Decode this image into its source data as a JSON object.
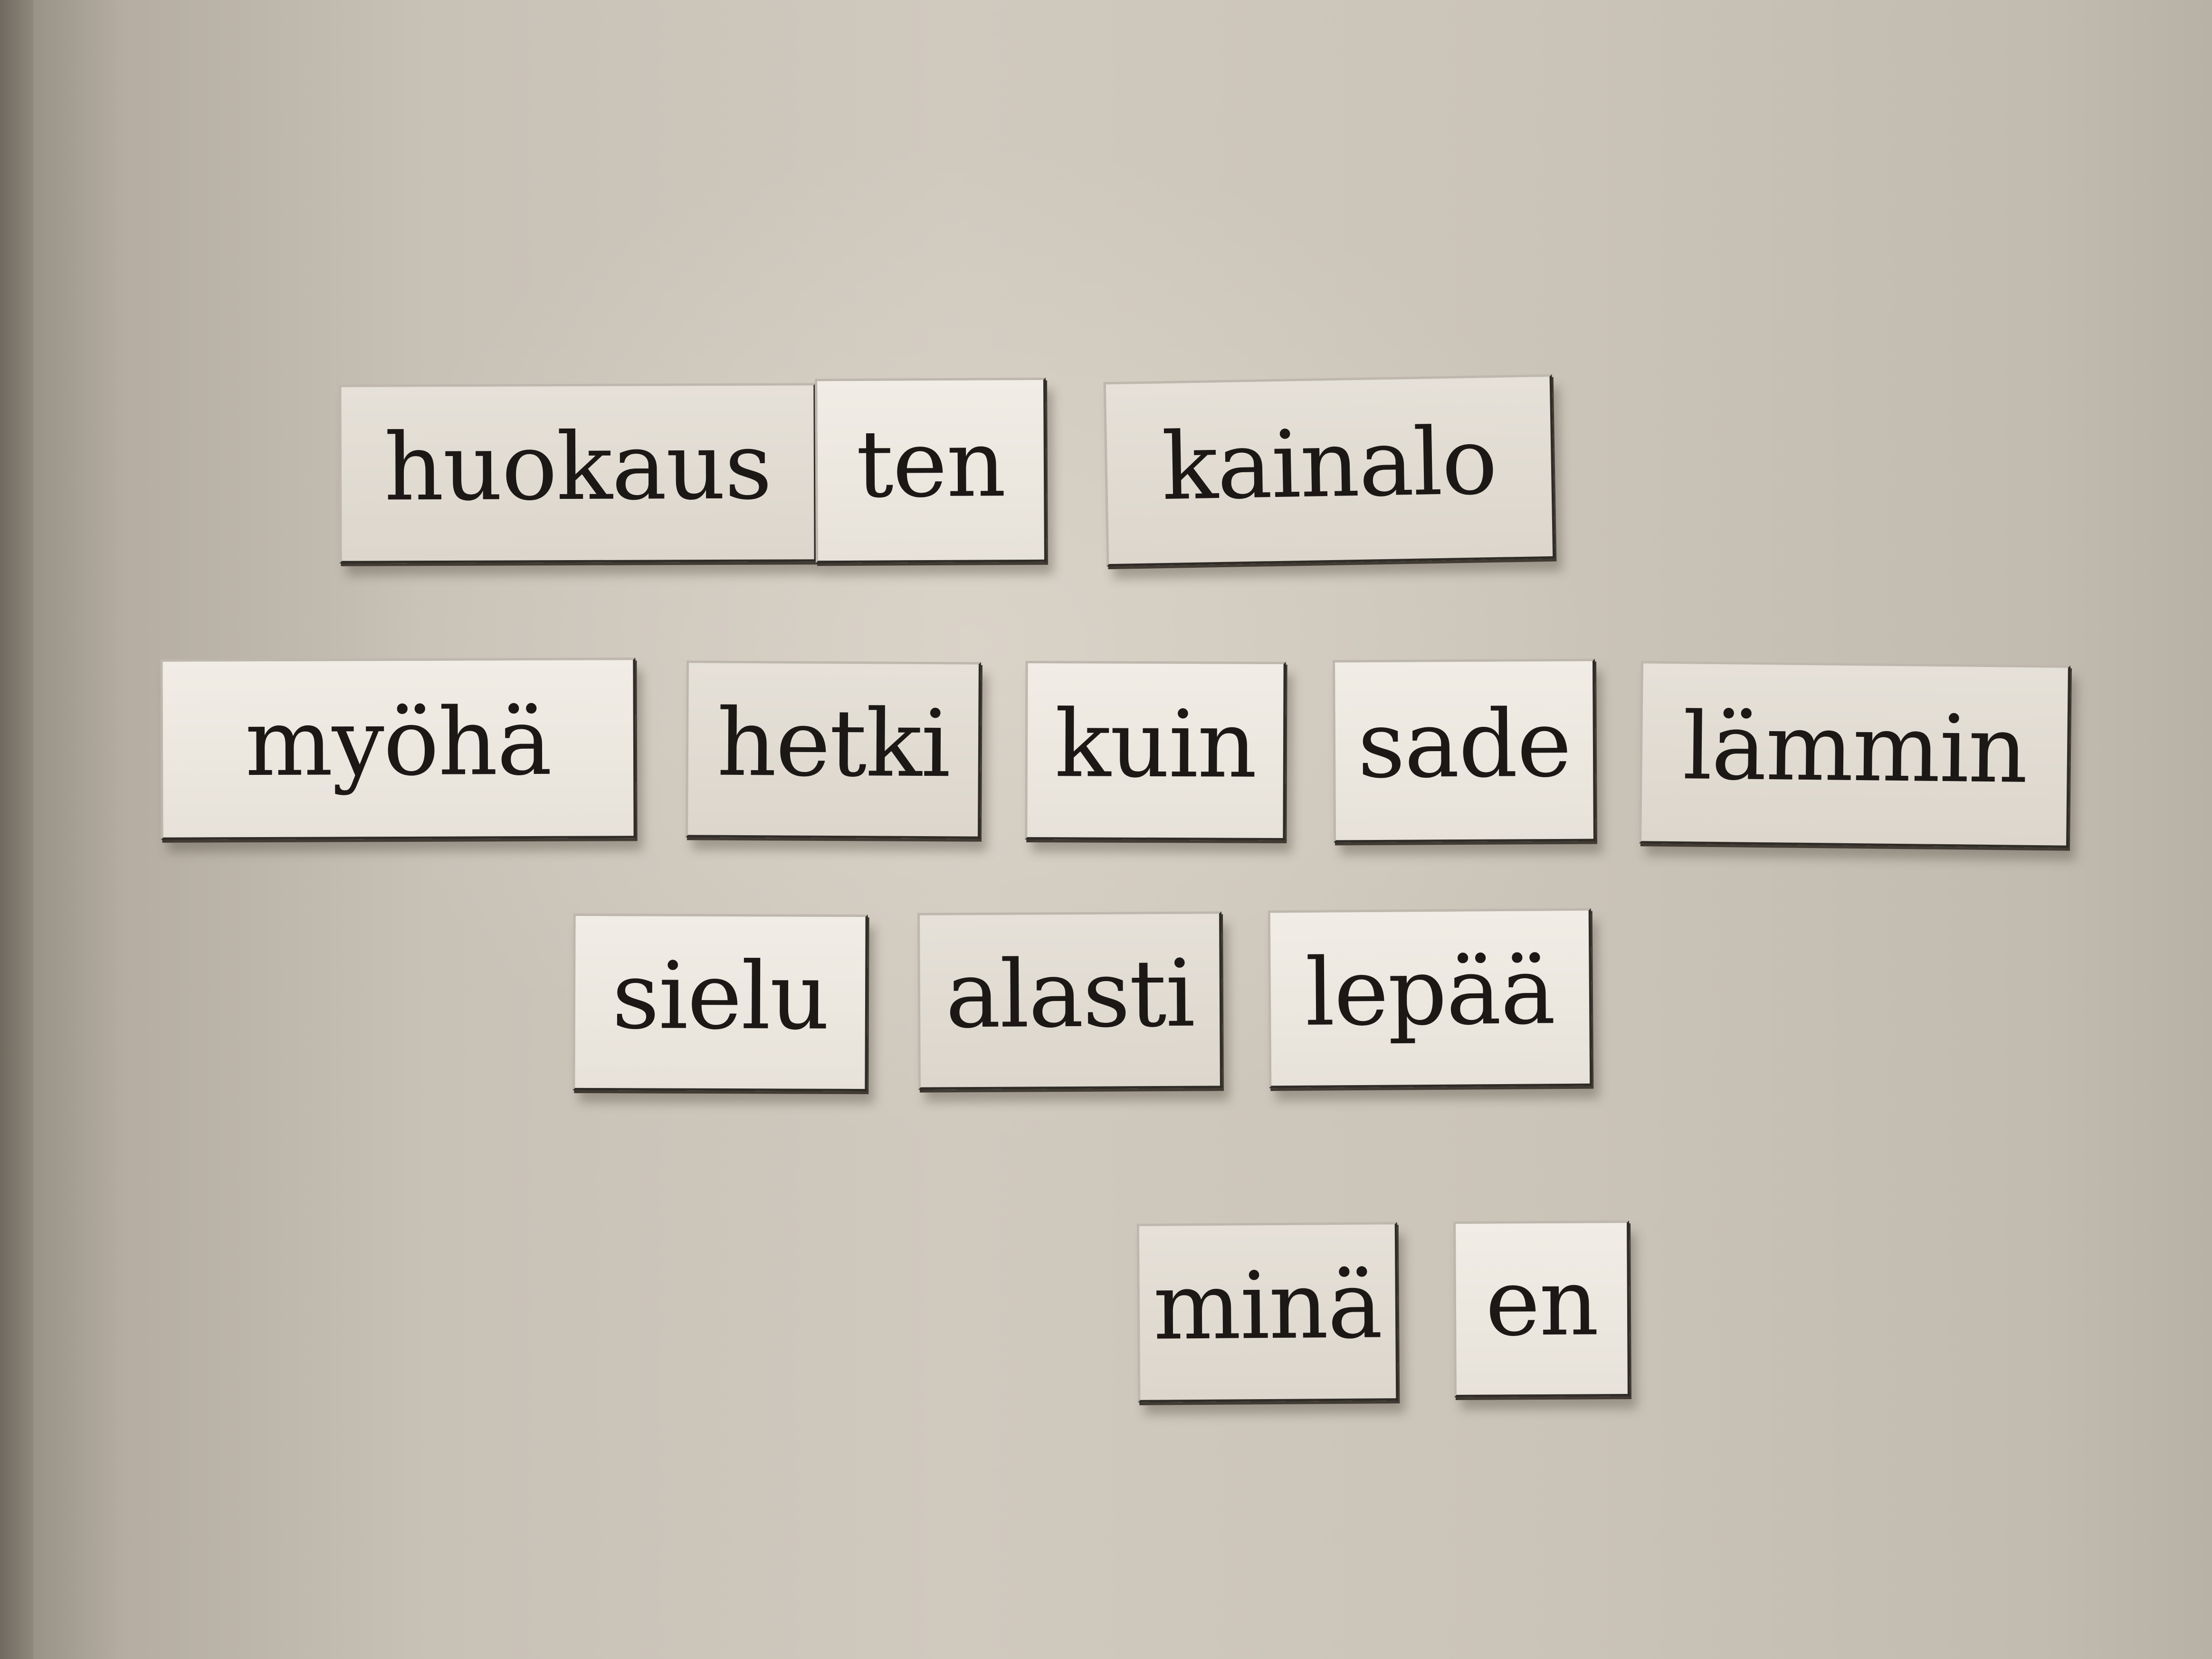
{
  "magnet_words": {
    "row1": [
      "huokaus",
      "ten",
      "kainalo"
    ],
    "row2": [
      "myöhä",
      "hetki",
      "kuin",
      "sade",
      "lämmin"
    ],
    "row3": [
      "sielu",
      "alasti",
      "lepää"
    ],
    "row4": [
      "minä",
      "en"
    ]
  },
  "colors": {
    "fridge": "#cfc8bd",
    "magnet": "#ece8e0",
    "ink": "#1b1816"
  }
}
